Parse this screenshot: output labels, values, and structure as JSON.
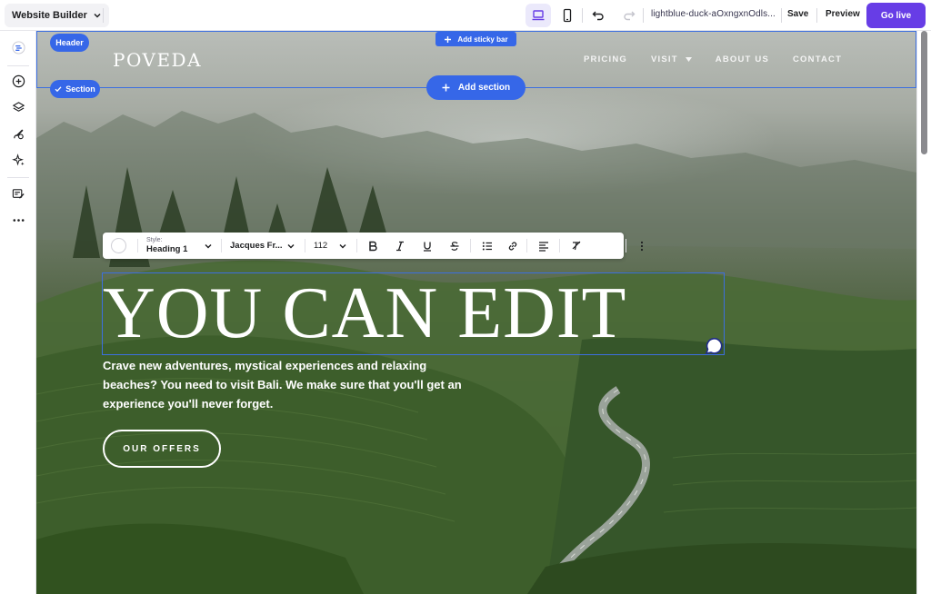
{
  "topbar": {
    "builder_label": "Website Builder",
    "site_url": "lightblue-duck-aOxngxnOdls...",
    "save_label": "Save",
    "preview_label": "Preview",
    "golive_label": "Go live"
  },
  "editor": {
    "header_tag": "Header",
    "section_tag": "Section",
    "sticky_bar_label": "Add sticky bar",
    "add_section_label": "Add section"
  },
  "format_toolbar": {
    "style_caption": "Style:",
    "style_value": "Heading 1",
    "font_value": "Jacques Fr...",
    "size_value": "112"
  },
  "site": {
    "logo": "POVEDA",
    "nav": [
      "PRICING",
      "VISIT",
      "ABOUT US",
      "CONTACT"
    ],
    "hero_heading": "YOU CAN EDIT",
    "hero_paragraph": "Crave new adventures, mystical experiences and relaxing beaches? You need to visit Bali. We make sure that you'll get an experience you'll never forget.",
    "cta_label": "OUR OFFERS"
  },
  "colors": {
    "accent": "#673de6",
    "editor_blue": "#3667e8"
  }
}
